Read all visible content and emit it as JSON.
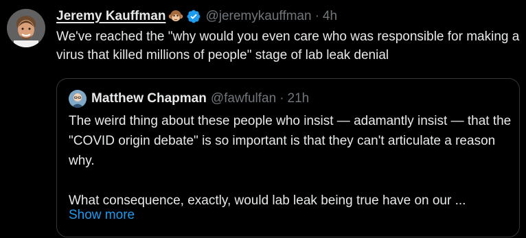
{
  "tweet": {
    "author_name": "Jeremy Kauffman",
    "author_emoji_icon": "monkey-face-icon",
    "verified_icon": "verified-badge-icon",
    "handle": "@jeremykauffman",
    "separator": "·",
    "time": "4h",
    "text": "We've reached the \"why would you even care who was responsible for making a virus that killed millions of people\" stage of lab leak denial",
    "avatar_icon": "profile-photo"
  },
  "quoted_tweet": {
    "author_name": "Matthew Chapman",
    "handle": "@fawfulfan",
    "separator": "·",
    "time": "21h",
    "avatar_icon": "cartoon-avatar-icon",
    "paragraph_1": "The weird thing about these people who insist — adamantly insist — that the \"COVID origin debate\" is so important is that they can't articulate a reason why.",
    "paragraph_2": "What consequence, exactly, would lab leak being true have on our ...",
    "show_more": "Show more"
  },
  "colors": {
    "background": "#000000",
    "text_primary": "#e7e9ea",
    "text_secondary": "#71767b",
    "accent_blue": "#1d9bf0",
    "border": "#333639"
  }
}
